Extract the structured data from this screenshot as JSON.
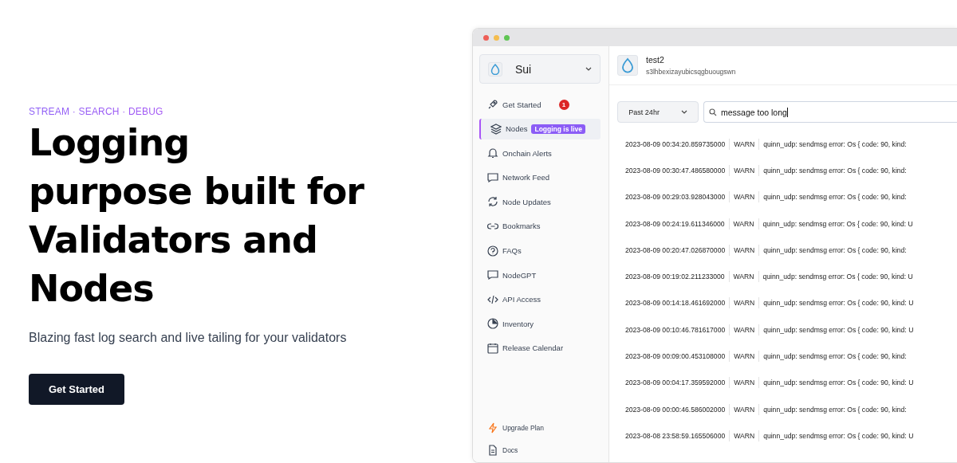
{
  "hero": {
    "eyebrow": "STREAM · SEARCH · DEBUG",
    "title_lines": [
      "Logging",
      "purpose built for",
      "Validators and",
      "Nodes"
    ],
    "subtitle": "Blazing fast log search and live tailing for your validators",
    "cta": "Get Started"
  },
  "app": {
    "network": {
      "name": "Sui"
    },
    "sidebar": {
      "items": [
        {
          "label": "Get Started",
          "selected": false,
          "count": "1"
        },
        {
          "label": "Nodes",
          "selected": true,
          "badge": "Logging is live"
        },
        {
          "label": "Onchain Alerts",
          "selected": false
        },
        {
          "label": "Network Feed",
          "selected": false
        },
        {
          "label": "Node Updates",
          "selected": false
        },
        {
          "label": "Bookmarks",
          "selected": false
        },
        {
          "label": "FAQs",
          "selected": false
        },
        {
          "label": "NodeGPT",
          "selected": false
        },
        {
          "label": "API Access",
          "selected": false
        },
        {
          "label": "Inventory",
          "selected": false
        },
        {
          "label": "Release Calendar",
          "selected": false
        }
      ],
      "footer_items": [
        {
          "label": "Upgrade Plan"
        },
        {
          "label": "Docs"
        }
      ]
    },
    "node": {
      "name": "test2",
      "id": "s3lhbexizayubicsqgbuougswn"
    },
    "range": {
      "value": "Past 24hr"
    },
    "search": {
      "value": "message too long"
    },
    "logs": [
      {
        "time": "2023-08-09 00:34:20.859735000",
        "level": "WARN",
        "message": "quinn_udp: sendmsg error: Os { code: 90, kind:"
      },
      {
        "time": "2023-08-09 00:30:47.486580000",
        "level": "WARN",
        "message": "quinn_udp: sendmsg error: Os { code: 90, kind:"
      },
      {
        "time": "2023-08-09 00:29:03.928043000",
        "level": "WARN",
        "message": "quinn_udp: sendmsg error: Os { code: 90, kind:"
      },
      {
        "time": "2023-08-09 00:24:19.611346000",
        "level": "WARN",
        "message": "quinn_udp: sendmsg error: Os { code: 90, kind: U"
      },
      {
        "time": "2023-08-09 00:20:47.026870000",
        "level": "WARN",
        "message": "quinn_udp: sendmsg error: Os { code: 90, kind:"
      },
      {
        "time": "2023-08-09 00:19:02.211233000",
        "level": "WARN",
        "message": "quinn_udp: sendmsg error: Os { code: 90, kind: U"
      },
      {
        "time": "2023-08-09 00:14:18.461692000",
        "level": "WARN",
        "message": "quinn_udp: sendmsg error: Os { code: 90, kind: U"
      },
      {
        "time": "2023-08-09 00:10:46.781617000",
        "level": "WARN",
        "message": "quinn_udp: sendmsg error: Os { code: 90, kind: U"
      },
      {
        "time": "2023-08-09 00:09:00.453108000",
        "level": "WARN",
        "message": "quinn_udp: sendmsg error: Os { code: 90, kind:"
      },
      {
        "time": "2023-08-09 00:04:17.359592000",
        "level": "WARN",
        "message": "quinn_udp: sendmsg error: Os { code: 90, kind: U"
      },
      {
        "time": "2023-08-09 00:00:46.586002000",
        "level": "WARN",
        "message": "quinn_udp: sendmsg error: Os { code: 90, kind:"
      },
      {
        "time": "2023-08-08 23:58:59.165506000",
        "level": "WARN",
        "message": "quinn_udp: sendmsg error: Os { code: 90, kind: U"
      }
    ]
  }
}
